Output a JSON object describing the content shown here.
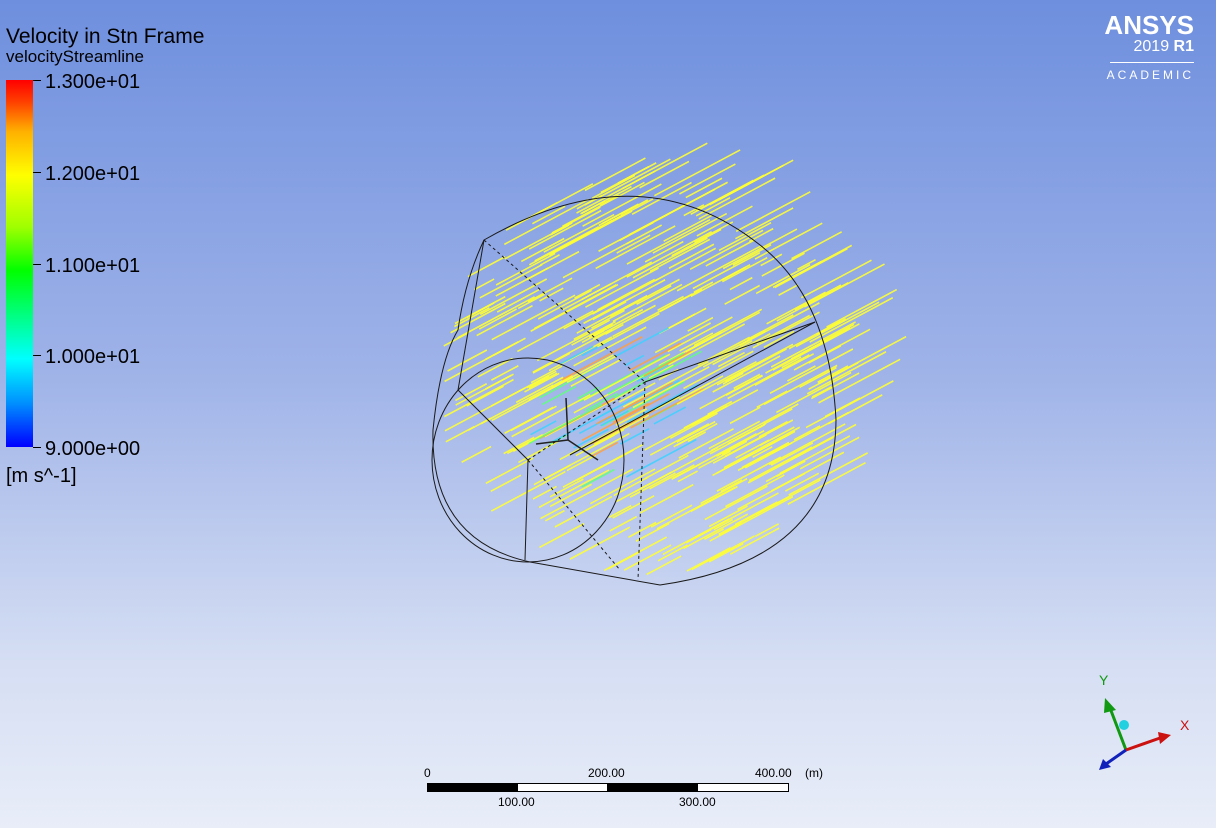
{
  "legend": {
    "title": "Velocity in Stn Frame",
    "subtitle": "velocityStreamline",
    "ticks": [
      "1.300e+01",
      "1.200e+01",
      "1.100e+01",
      "1.000e+01",
      "9.000e+00"
    ],
    "unit": "[m s^-1]",
    "colors": [
      "#0000ff",
      "#00ffff",
      "#00ff00",
      "#ffff00",
      "#ff0000"
    ]
  },
  "logo": {
    "name": "ANSYS",
    "version_year": "2019",
    "version_release": "R1",
    "edition": "ACADEMIC"
  },
  "scale": {
    "top_labels": [
      "0",
      "200.00",
      "400.00"
    ],
    "unit": "(m)",
    "bottom_labels": [
      "100.00",
      "300.00"
    ]
  },
  "axes": {
    "x_label": "X",
    "y_label": "Y",
    "x_color": "#cc1111",
    "y_color": "#119911",
    "z_color": "#1122bb"
  },
  "streamlines": {
    "dominant_color": "#ffff33",
    "core_colors": [
      "#40d0ff",
      "#ffa040",
      "#60ff80"
    ]
  }
}
